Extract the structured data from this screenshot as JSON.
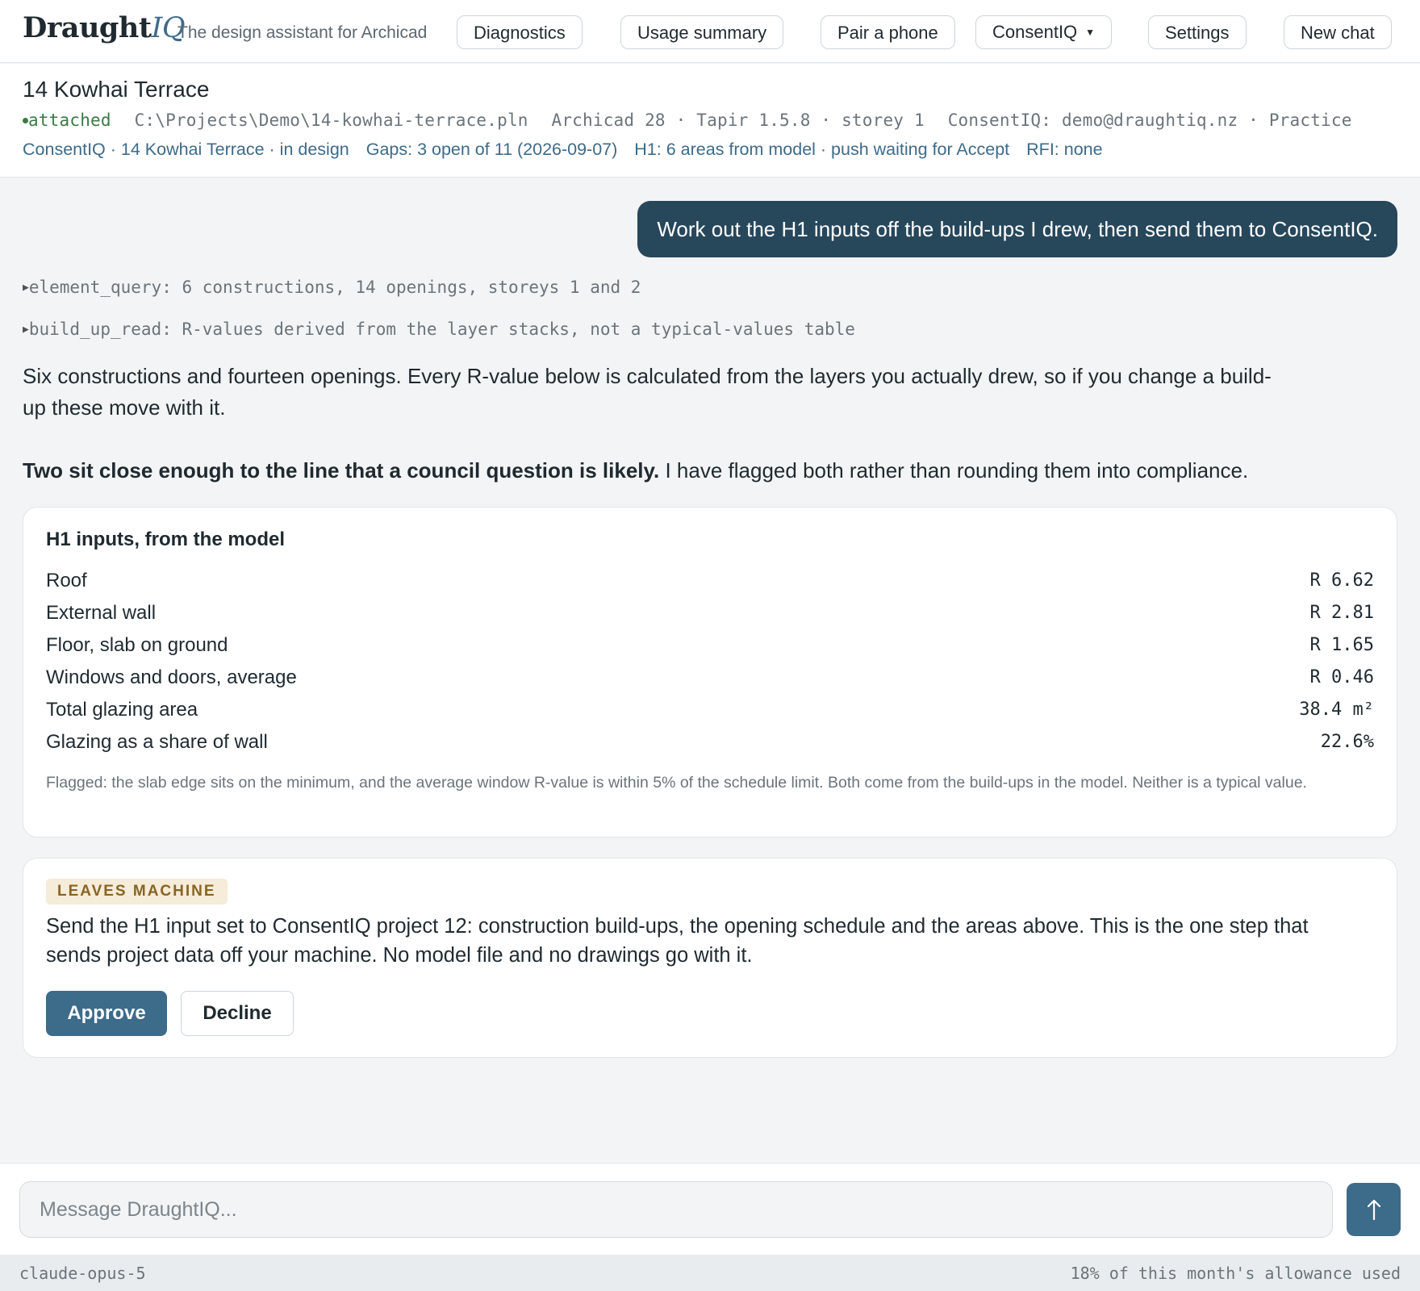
{
  "header": {
    "logo_main": "Draught",
    "logo_accent": "IQ",
    "tagline": "The design assistant for Archicad",
    "buttons": {
      "diagnostics": "Diagnostics",
      "usage": "Usage summary",
      "pair": "Pair a phone",
      "consentiq": "ConsentIQ",
      "settings": "Settings",
      "new_chat": "New chat"
    }
  },
  "project": {
    "title": "14 Kowhai Terrace",
    "status": "attached",
    "path": "C:\\Projects\\Demo\\14-kowhai-terrace.pln",
    "app_info": "Archicad 28 · Tapir 1.5.8 · storey 1",
    "account": "ConsentIQ: demo@draughtiq.nz · Practice",
    "links": {
      "project": "ConsentIQ · 14 Kowhai Terrace · in design",
      "gaps": "Gaps: 3 open of 11 (2026-09-07)",
      "h1": "H1: 6 areas from model · push waiting for Accept",
      "rfi": "RFI: none"
    }
  },
  "chat": {
    "user_message": "Work out the H1 inputs off the build-ups I drew, then send them to ConsentIQ.",
    "tool_calls": [
      "element_query: 6 constructions, 14 openings, storeys 1 and 2",
      "build_up_read: R-values derived from the layer stacks, not a typical-values table"
    ],
    "para1": "Six constructions and fourteen openings. Every R-value below is calculated from the layers you actually drew, so if you change a build-up these move with it.",
    "para2_bold": "Two sit close enough to the line that a council question is likely.",
    "para2_rest": " I have flagged both rather than rounding them into compliance.",
    "h1_card": {
      "title": "H1 inputs, from the model",
      "rows": [
        {
          "label": "Roof",
          "value": "R 6.62"
        },
        {
          "label": "External wall",
          "value": "R 2.81"
        },
        {
          "label": "Floor, slab on ground",
          "value": "R 1.65"
        },
        {
          "label": "Windows and doors, average",
          "value": "R 0.46"
        },
        {
          "label": "Total glazing area",
          "value": "38.4 m²"
        },
        {
          "label": "Glazing as a share of wall",
          "value": "22.6%"
        }
      ],
      "note": "Flagged: the slab edge sits on the minimum, and the average window R-value is within 5% of the schedule limit. Both come from the build-ups in the model. Neither is a typical value."
    },
    "approval": {
      "badge": "LEAVES MACHINE",
      "text": "Send the H1 input set to ConsentIQ project 12: construction build-ups, the opening schedule and the areas above. This is the one step that sends project data off your machine. No model file and no drawings go with it.",
      "approve": "Approve",
      "decline": "Decline"
    }
  },
  "composer": {
    "placeholder": "Message DraughtIQ..."
  },
  "footer": {
    "model": "claude-opus-5",
    "usage": "18% of this month's allowance used"
  }
}
